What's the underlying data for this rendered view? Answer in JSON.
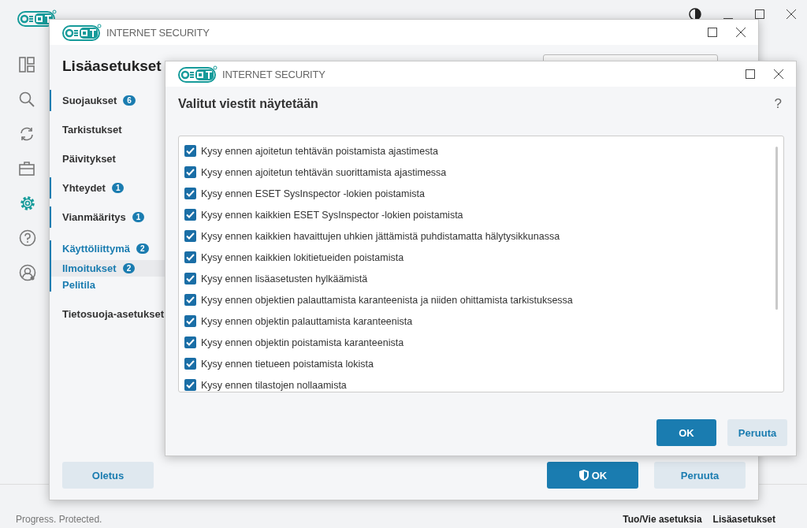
{
  "app": {
    "sidebar": [
      {
        "kind": "dashboard",
        "selected": false
      },
      {
        "kind": "search",
        "selected": false
      },
      {
        "kind": "refresh",
        "selected": false
      },
      {
        "kind": "briefcase",
        "selected": false
      },
      {
        "kind": "gear",
        "selected": true
      },
      {
        "kind": "help",
        "selected": false
      },
      {
        "kind": "account",
        "selected": false
      }
    ],
    "status_bar": {
      "text": "Progress. Protected.",
      "links": [
        {
          "label": "Tuo/Vie asetuksia"
        },
        {
          "label": "Lisäasetukset"
        }
      ]
    }
  },
  "settings_window": {
    "title": "INTERNET SECURITY",
    "heading": "Lisäasetukset",
    "nav": [
      {
        "label": "Suojaukset",
        "badge": "6",
        "expanded": false
      },
      {
        "label": "Tarkistukset",
        "expanded": false
      },
      {
        "label": "Päivitykset",
        "expanded": false
      },
      {
        "label": "Yhteydet",
        "badge": "1",
        "expanded": false
      },
      {
        "label": "Vianmääritys",
        "badge": "1",
        "expanded": false
      },
      {
        "label": "Käyttöliittymä",
        "badge": "2",
        "expanded": true,
        "children": [
          {
            "label": "Ilmoitukset",
            "badge": "2",
            "selected": true
          },
          {
            "label": "Pelitila",
            "selected": false
          }
        ]
      },
      {
        "label": "Tietosuoja-asetukset",
        "expanded": false
      }
    ],
    "buttons": [
      {
        "label": "Oletus",
        "kind": "secondary"
      },
      {
        "label": "OK",
        "kind": "primary-shield"
      },
      {
        "label": "Peruuta",
        "kind": "secondary"
      }
    ]
  },
  "dialog": {
    "title": "INTERNET SECURITY",
    "heading": "Valitut viestit näytetään",
    "help": "?",
    "options": [
      {
        "label": "Kysy ennen ajoitetun tehtävän poistamista ajastimesta",
        "checked": true
      },
      {
        "label": "Kysy ennen ajoitetun tehtävän suorittamista ajastimessa",
        "checked": true
      },
      {
        "label": "Kysy ennen ESET SysInspector -lokien poistamista",
        "checked": true
      },
      {
        "label": "Kysy ennen kaikkien ESET SysInspector -lokien poistamista",
        "checked": true
      },
      {
        "label": "Kysy ennen kaikkien havaittujen uhkien jättämistä puhdistamatta hälytysikkunassa",
        "checked": true
      },
      {
        "label": "Kysy ennen kaikkien lokitietueiden poistamista",
        "checked": true
      },
      {
        "label": "Kysy ennen lisäasetusten hylkäämistä",
        "checked": true
      },
      {
        "label": "Kysy ennen objektien palauttamista karanteenista ja niiden ohittamista tarkistuksessa",
        "checked": true
      },
      {
        "label": "Kysy ennen objektin palauttamista karanteenista",
        "checked": true
      },
      {
        "label": "Kysy ennen objektin poistamista karanteenista",
        "checked": true
      },
      {
        "label": "Kysy ennen tietueen poistamista lokista",
        "checked": true
      },
      {
        "label": "Kysy ennen tilastojen nollaamista",
        "checked": true
      }
    ],
    "buttons": [
      {
        "label": "OK",
        "kind": "primary"
      },
      {
        "label": "Peruuta",
        "kind": "secondary"
      }
    ]
  }
}
